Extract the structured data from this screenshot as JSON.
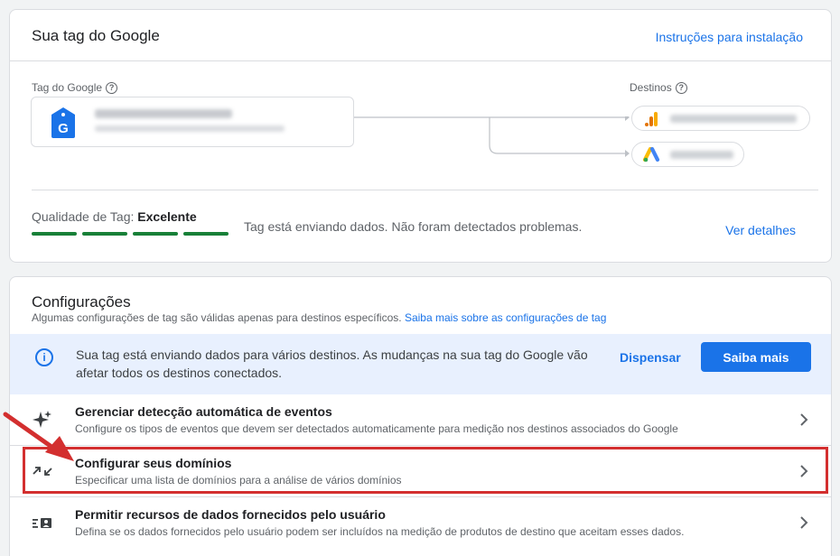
{
  "tag_card": {
    "title": "Sua tag do Google",
    "install_link": "Instruções para instalação",
    "tag_label": "Tag do Google",
    "destinations_label": "Destinos",
    "help_glyph": "?",
    "logo_letter": "G",
    "quality_label": "Qualidade de Tag:",
    "quality_value": "Excelente",
    "quality_status": "Tag está enviando dados. Não foram detectados problemas.",
    "details_link": "Ver detalhes",
    "quality_bars": 4,
    "quality_color": "#188038"
  },
  "config_card": {
    "title": "Configurações",
    "subtitle": "Algumas configurações de tag são válidas apenas para destinos específicos.",
    "subtitle_link": "Saiba mais sobre as configurações de tag",
    "banner": {
      "text": "Sua tag está enviando dados para vários destinos. As mudanças na sua tag do Google vão afetar todos os destinos conectados.",
      "dismiss": "Dispensar",
      "learn_more": "Saiba mais",
      "info_glyph": "i"
    },
    "rows": [
      {
        "title": "Gerenciar detecção automática de eventos",
        "description": "Configure os tipos de eventos que devem ser detectados automaticamente para medição nos destinos associados do Google",
        "icon": "sparkle-icon"
      },
      {
        "title": "Configurar seus domínios",
        "description": "Especificar uma lista de domínios para a análise de vários domínios",
        "icon": "merge-arrows-icon"
      },
      {
        "title": "Permitir recursos de dados fornecidos pelo usuário",
        "description": "Defina se os dados fornecidos pelo usuário podem ser incluídos na medição de produtos de destino que aceitam esses dados.",
        "icon": "user-data-icon"
      }
    ]
  },
  "colors": {
    "accent": "#1a73e8",
    "highlight": "#d32f2f",
    "banner_bg": "#e8f0fe"
  }
}
